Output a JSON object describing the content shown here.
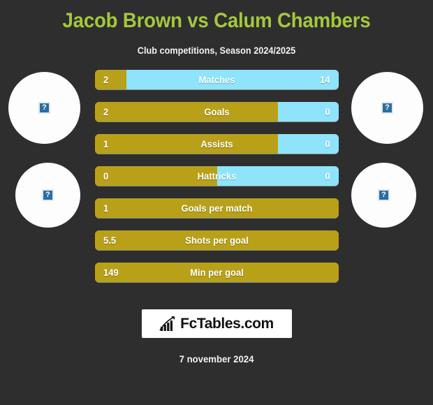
{
  "header": {
    "title": "Jacob Brown vs Calum Chambers",
    "subtitle": "Club competitions, Season 2024/2025",
    "title_color": "#a6c73c"
  },
  "colors": {
    "background": "#2e2e2e",
    "home": "#b8a019",
    "away": "#8ee4fb",
    "title": "#a6c73c",
    "text": "#ffffff"
  },
  "avatars": [
    {
      "position": "home-top",
      "icon": "broken-image-icon",
      "glyph": "?"
    },
    {
      "position": "away-top",
      "icon": "broken-image-icon",
      "glyph": "?"
    },
    {
      "position": "home-bottom",
      "icon": "broken-image-icon",
      "glyph": "?"
    },
    {
      "position": "away-bottom",
      "icon": "broken-image-icon",
      "glyph": "?"
    }
  ],
  "chart_data": {
    "type": "bar",
    "title": "Jacob Brown vs Calum Chambers",
    "subtitle": "Club competitions, Season 2024/2025",
    "orientation": "horizontal-diverging",
    "legend": [
      "Jacob Brown",
      "Calum Chambers"
    ],
    "categories": [
      "Matches",
      "Goals",
      "Assists",
      "Hattricks",
      "Goals per match",
      "Shots per goal",
      "Min per goal"
    ],
    "series": [
      {
        "name": "Jacob Brown",
        "values": [
          "2",
          "2",
          "1",
          "0",
          "1",
          "5.5",
          "149"
        ]
      },
      {
        "name": "Calum Chambers",
        "values": [
          "14",
          "0",
          "0",
          "0",
          "",
          "",
          ""
        ]
      }
    ],
    "left_percents": [
      13,
      75,
      75,
      50,
      100,
      100,
      100
    ],
    "right_percents": [
      87,
      25,
      25,
      50,
      0,
      0,
      0
    ]
  },
  "rows": [
    {
      "label": "Matches",
      "left": "2",
      "right": "14",
      "left_pct": 13,
      "right_pct": 87,
      "has_right": true
    },
    {
      "label": "Goals",
      "left": "2",
      "right": "0",
      "left_pct": 75,
      "right_pct": 25,
      "has_right": true
    },
    {
      "label": "Assists",
      "left": "1",
      "right": "0",
      "left_pct": 75,
      "right_pct": 25,
      "has_right": true
    },
    {
      "label": "Hattricks",
      "left": "0",
      "right": "0",
      "left_pct": 50,
      "right_pct": 50,
      "has_right": true
    },
    {
      "label": "Goals per match",
      "left": "1",
      "right": "",
      "left_pct": 100,
      "right_pct": 0,
      "has_right": false
    },
    {
      "label": "Shots per goal",
      "left": "5.5",
      "right": "",
      "left_pct": 100,
      "right_pct": 0,
      "has_right": false
    },
    {
      "label": "Min per goal",
      "left": "149",
      "right": "",
      "left_pct": 100,
      "right_pct": 0,
      "has_right": false
    }
  ],
  "footer": {
    "logo_text": "FcTables.com",
    "logo_icon": "bar-chart-icon",
    "date": "7 november 2024"
  }
}
